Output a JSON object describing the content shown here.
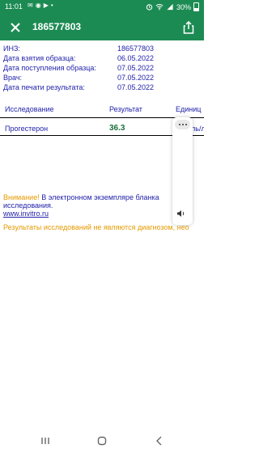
{
  "status_bar": {
    "time": "11:01",
    "notifications": [
      "✉",
      "◉",
      "▶",
      "•"
    ],
    "battery_text": "30%"
  },
  "app_bar": {
    "title": "186577803"
  },
  "info": [
    {
      "key": "ИНЗ:",
      "value": "186577803"
    },
    {
      "key": "Дата взятия образца:",
      "value": "06.05.2022"
    },
    {
      "key": "Дата поступления образца:",
      "value": "07.05.2022"
    },
    {
      "key": "Врач:",
      "value": "07.05.2022"
    },
    {
      "key": "Дата печати результата:",
      "value": "07.05.2022"
    }
  ],
  "table": {
    "headers": [
      "Исследование",
      "Результат",
      "Единиц"
    ],
    "row": {
      "name": "Прогестерон",
      "value": "36.3",
      "unit": "ль/л"
    }
  },
  "note": {
    "warning": "Внимание!",
    "text": " В электронном экземпляре бланка",
    "text2": "исследования.",
    "link": "www.invitro.ru"
  },
  "disclaimer": "Результаты исследований не являются диагнозом, нео"
}
